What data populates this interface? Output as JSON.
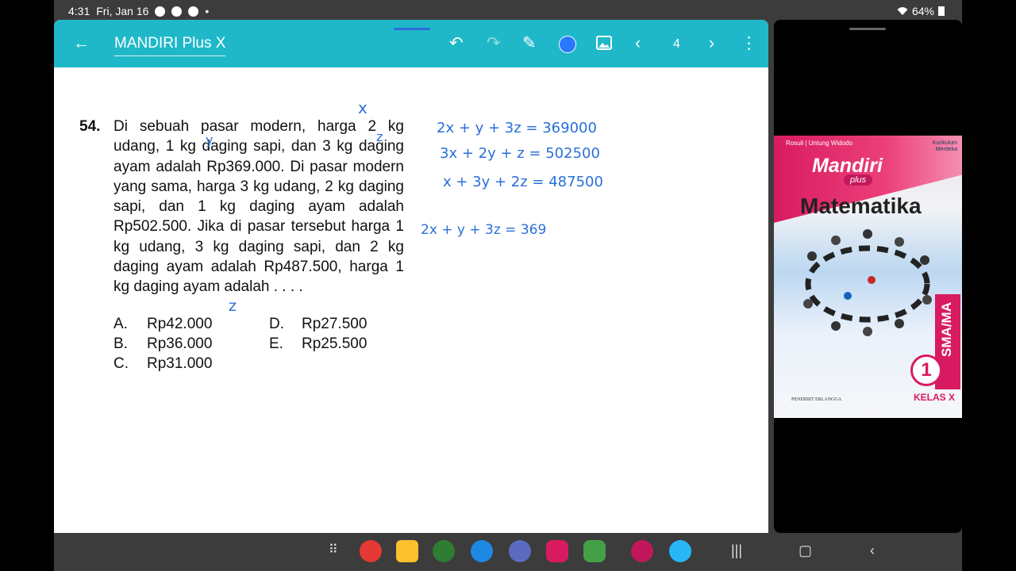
{
  "status": {
    "time": "4:31",
    "date": "Fri, Jan 16",
    "battery": "64%"
  },
  "app": {
    "title": "MANDIRI Plus X",
    "page": "4"
  },
  "question": {
    "number": "54.",
    "text": "Di sebuah pasar modern, harga 2 kg udang, 1 kg daging sapi, dan 3 kg daging ayam adalah Rp369.000. Di pasar modern yang sama, harga 3 kg udang, 2 kg daging sapi, dan 1 kg daging ayam adalah Rp502.500. Jika di pasar tersebut harga 1 kg udang, 3 kg daging sapi, dan 2 kg daging ayam adalah Rp487.500, harga 1 kg daging ayam adalah . . . .",
    "options": [
      {
        "letter": "A.",
        "value": "Rp42.000"
      },
      {
        "letter": "B.",
        "value": "Rp36.000"
      },
      {
        "letter": "C.",
        "value": "Rp31.000"
      },
      {
        "letter": "D.",
        "value": "Rp27.500"
      },
      {
        "letter": "E.",
        "value": "Rp25.500"
      }
    ]
  },
  "handwriting": {
    "mark_x": "x",
    "mark_y": "y",
    "mark_z": "z",
    "mark_z_option": "z",
    "eq1": "2x + y + 3z = 369000",
    "eq2": "3x + 2y + z = 502500",
    "eq3": "x + 3y + 2z = 487500",
    "eq4": "2x + y + 3z = 369"
  },
  "cover": {
    "authors": "Rosuli | Untung Widodo",
    "curriculum": "Kurikulum Merdeka",
    "brand": "Mandiri",
    "brand_plus": "plus",
    "subject": "Matematika",
    "level": "SMA/MA",
    "grade": "1",
    "kelas": "KELAS X",
    "publisher": "PENERBIT ERLANGGA"
  },
  "colors": {
    "appbar": "#1fb8c8",
    "ink": "#2a6fdb",
    "accent": "#d81b60"
  }
}
